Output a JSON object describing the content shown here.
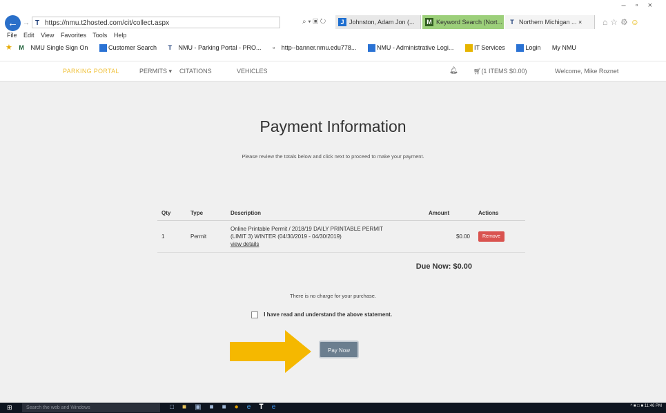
{
  "browser": {
    "address": "https://nmu.t2hosted.com/cit/collect.aspx",
    "window_controls": [
      "–",
      "▫",
      "×"
    ],
    "tabs": [
      {
        "label": "Johnston, Adam Jon (...",
        "icon": "J"
      },
      {
        "label": "Keyword Search (Nort...",
        "icon": "M"
      },
      {
        "label": "Northern Michigan ... ×",
        "icon": "T"
      }
    ],
    "menu": [
      "File",
      "Edit",
      "View",
      "Favorites",
      "Tools",
      "Help"
    ],
    "favorites": [
      "NMU Single Sign On",
      "Customer Search",
      "NMU - Parking Portal - PRO...",
      "http--banner.nmu.edu778...",
      "NMU - Administrative Logi...",
      "IT Services",
      "Login",
      "My NMU"
    ]
  },
  "site_nav": {
    "brand": "PARKING PORTAL",
    "items": [
      "PERMITS ▾",
      "CITATIONS",
      "VEHICLES"
    ],
    "cart": "(1 ITEMS $0.00)",
    "welcome": "Welcome, Mike Roznet"
  },
  "page": {
    "title": "Payment Information",
    "subtitle": "Please review the totals below and click next to proceed to make your payment.",
    "table": {
      "headers": [
        "Qty",
        "Type",
        "Description",
        "Amount",
        "Actions"
      ],
      "rows": [
        {
          "qty": "1",
          "type": "Permit",
          "description_line1": "Online Printable Permit / 2018/19 DAILY PRINTABLE PERMIT",
          "description_line2": "(LIMIT 3) WINTER (04/30/2019 - 04/30/2019)",
          "view_details": "view details",
          "amount": "$0.00",
          "action": "Remove"
        }
      ]
    },
    "due_now": "Due Now: $0.00",
    "no_charge": "There is no charge for your purchase.",
    "agree_label": "I have read and understand the above statement.",
    "pay_button": "Pay Now"
  },
  "taskbar": {
    "search_placeholder": "Search the web and Windows",
    "clock": "11:46 PM"
  },
  "colors": {
    "accent_arrow": "#f5b800",
    "pay_button": "#6b7e8f",
    "remove_button": "#d9534f",
    "brand": "#f0c23b"
  }
}
